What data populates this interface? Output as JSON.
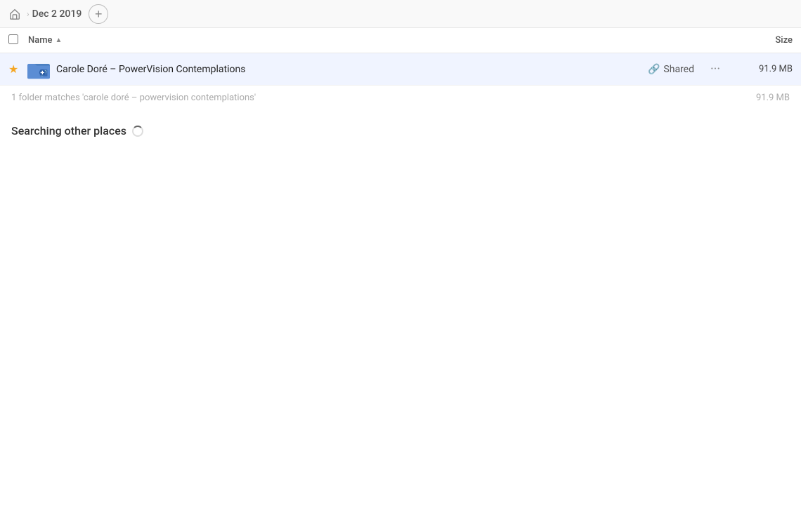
{
  "topbar": {
    "home_label": "Home",
    "breadcrumb_date": "Dec 2 2019",
    "add_label": "+"
  },
  "columns": {
    "name_label": "Name",
    "sort_direction": "▲",
    "size_label": "Size"
  },
  "file_row": {
    "name": "Carole Doré – PowerVision Contemplations",
    "shared_label": "Shared",
    "size": "91.9 MB"
  },
  "match_row": {
    "text": "1 folder matches 'carole doré – powervision contemplations'",
    "size": "91.9 MB"
  },
  "searching": {
    "label": "Searching other places"
  }
}
